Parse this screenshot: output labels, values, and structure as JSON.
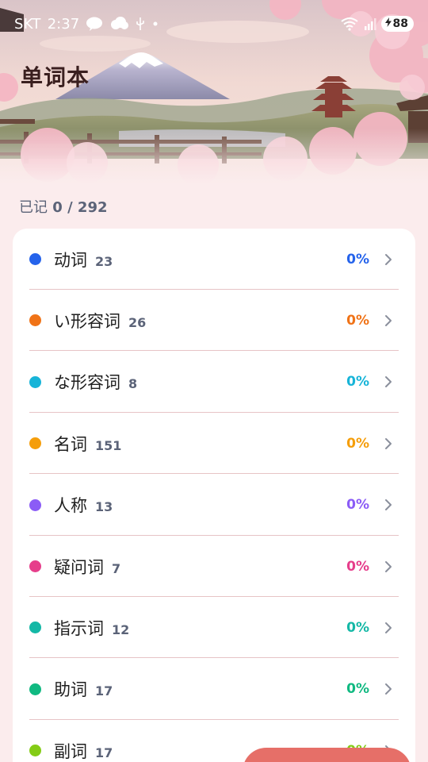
{
  "status_bar": {
    "carrier": "SKT",
    "time": "2:37",
    "battery": "88",
    "icons": [
      "talk-icon",
      "cloud-icon",
      "usb-icon",
      "dot-icon",
      "wifi-icon",
      "signal-icon",
      "charging-icon"
    ]
  },
  "header": {
    "title": "单词本"
  },
  "summary": {
    "label": "已记",
    "value": "0 / 292"
  },
  "categories": [
    {
      "name": "动词",
      "count": "23",
      "percent": "0%",
      "color": "#2563eb"
    },
    {
      "name": "い形容词",
      "count": "26",
      "percent": "0%",
      "color": "#f07317"
    },
    {
      "name": "な形容词",
      "count": "8",
      "percent": "0%",
      "color": "#17b4d8"
    },
    {
      "name": "名词",
      "count": "151",
      "percent": "0%",
      "color": "#f59e0b"
    },
    {
      "name": "人称",
      "count": "13",
      "percent": "0%",
      "color": "#8b5cf6"
    },
    {
      "name": "疑问词",
      "count": "7",
      "percent": "0%",
      "color": "#e63e8b"
    },
    {
      "name": "指示词",
      "count": "12",
      "percent": "0%",
      "color": "#14b8a6"
    },
    {
      "name": "助词",
      "count": "17",
      "percent": "0%",
      "color": "#10b981"
    },
    {
      "name": "副词",
      "count": "17",
      "percent": "0%",
      "color": "#84cc16"
    }
  ],
  "fab": {
    "color": "#e66f68"
  }
}
